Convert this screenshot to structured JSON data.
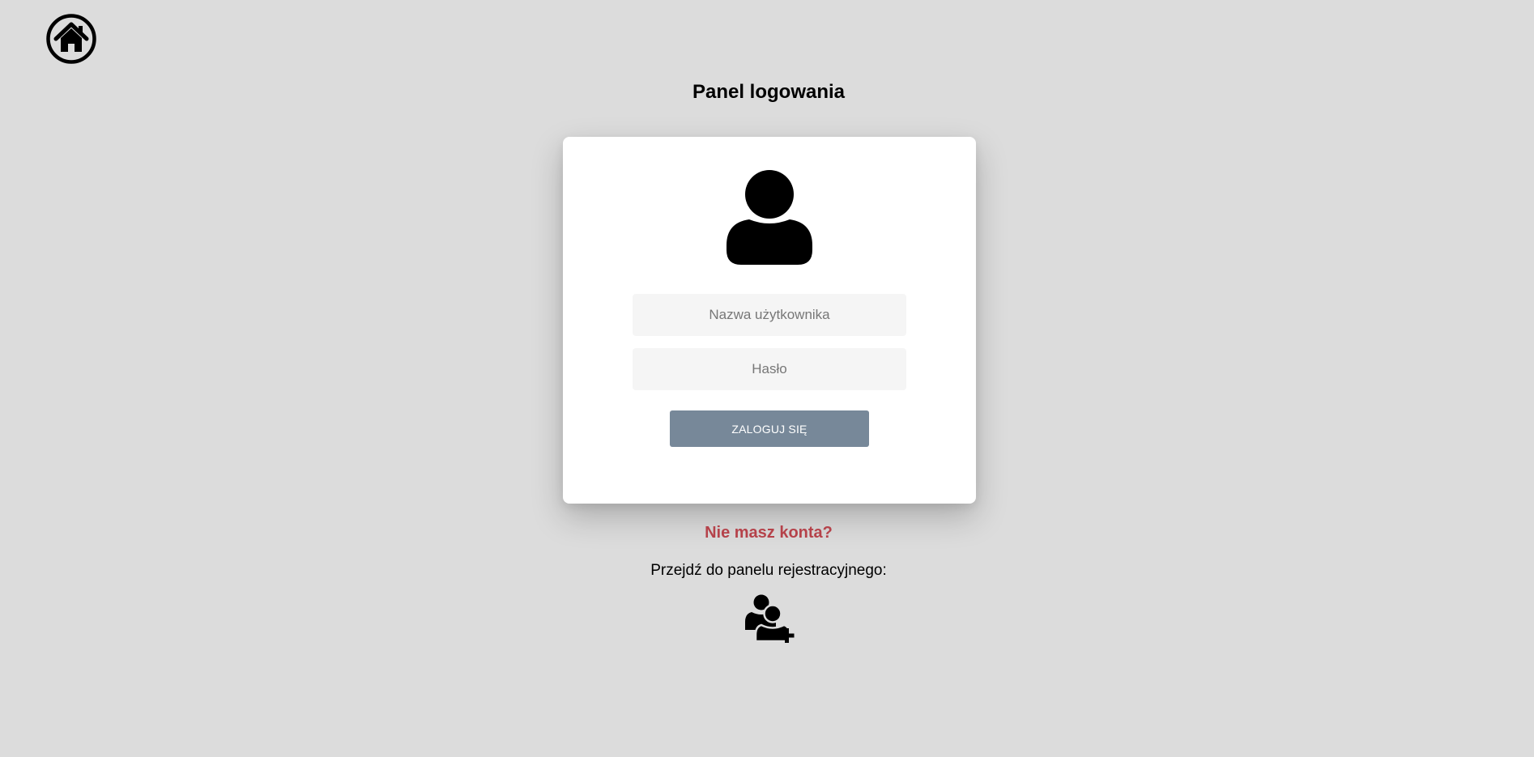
{
  "header": {
    "home_icon": "home-icon",
    "title": "Panel logowania"
  },
  "login_form": {
    "avatar_icon": "user-icon",
    "username_placeholder": "Nazwa użytkownika",
    "username_value": "",
    "password_placeholder": "Hasło",
    "password_value": "",
    "submit_label": "ZALOGUJ SIĘ"
  },
  "register": {
    "question": "Nie masz konta?",
    "prompt": "Przejdź do panelu rejestracyjnego:",
    "icon": "user-plus-icon"
  },
  "colors": {
    "background": "#dcdcdc",
    "card": "#ffffff",
    "button": "#778899",
    "accent_link": "#b5424a",
    "input_bg": "#f5f5f5"
  }
}
